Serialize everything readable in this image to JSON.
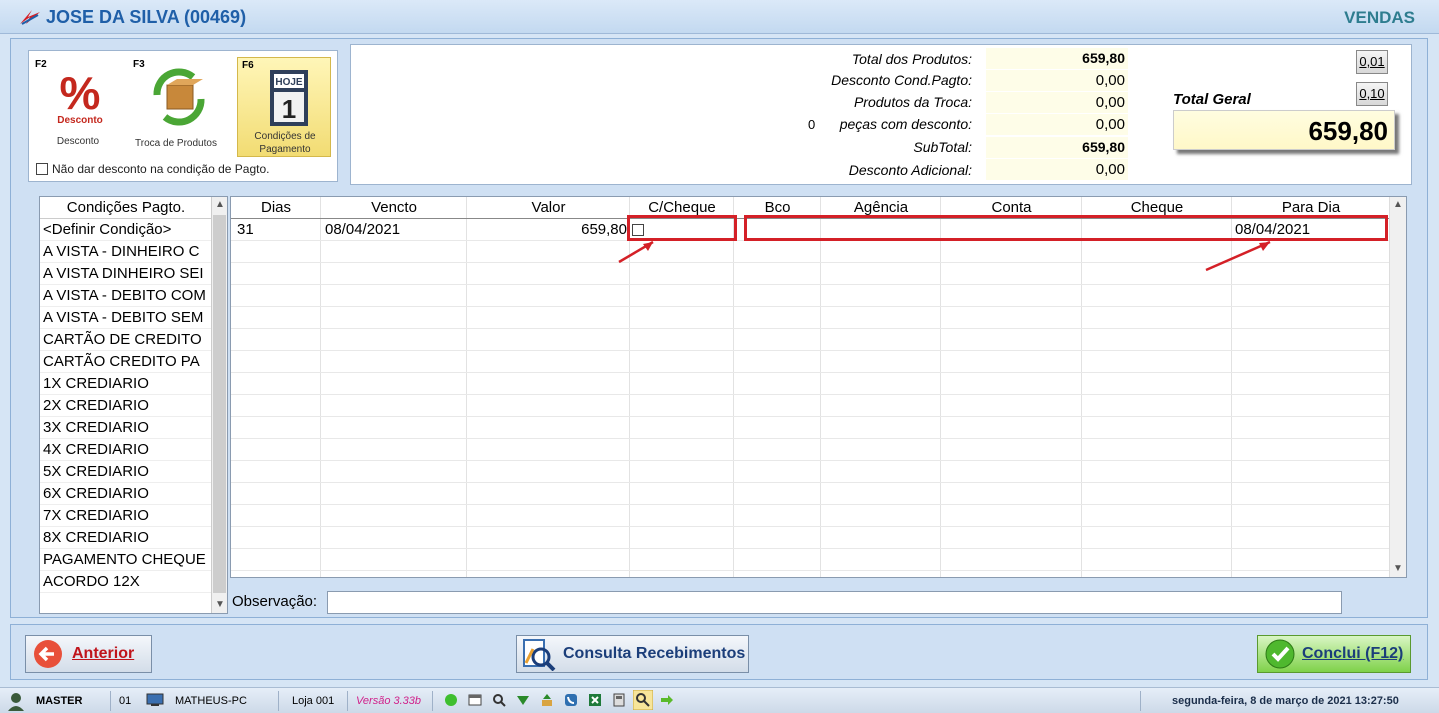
{
  "header": {
    "customer": "JOSE DA SILVA (00469)",
    "module": "VENDAS"
  },
  "tools": {
    "desconto": {
      "key": "F2",
      "label": "Desconto",
      "icon_text": "Desconto"
    },
    "troca": {
      "key": "F3",
      "label": "Troca de Produtos"
    },
    "condicoes": {
      "key": "F6",
      "label_line1": "Condições de",
      "label_line2": "Pagamento",
      "icon_text": "HOJE",
      "icon_num": "1"
    },
    "no_discount_label": "Não dar desconto na condição de Pagto."
  },
  "totals": {
    "total_produtos_label": "Total dos Produtos:",
    "total_produtos": "659,80",
    "desconto_cond_label": "Desconto Cond.Pagto:",
    "desconto_cond": "0,00",
    "produtos_troca_label": "Produtos da Troca:",
    "produtos_troca": "0,00",
    "pecas_count": "0",
    "pecas_label": "peças com desconto:",
    "pecas_desconto": "0,00",
    "subtotal_label": "SubTotal:",
    "subtotal": "659,80",
    "desconto_adic_label": "Desconto Adicional:",
    "desconto_adic": "0,00",
    "total_geral_label": "Total Geral",
    "total_geral": "659,80",
    "btn_001": "0,01",
    "btn_010": "0,10"
  },
  "conditions": {
    "header": "Condições Pagto.",
    "items": [
      "<Definir Condição>",
      "A VISTA - DINHEIRO C",
      "A VISTA DINHEIRO SEI",
      "A VISTA - DEBITO COM",
      "A VISTA - DEBITO SEM",
      "CARTÃO DE CREDITO",
      "CARTÃO CREDITO PA",
      "1X CREDIARIO",
      "2X CREDIARIO",
      "3X CREDIARIO",
      "4X CREDIARIO",
      "5X CREDIARIO",
      "6X CREDIARIO",
      "7X CREDIARIO",
      "8X CREDIARIO",
      "PAGAMENTO CHEQUE",
      "ACORDO 12X"
    ]
  },
  "grid": {
    "columns": [
      "Dias",
      "Vencto",
      "Valor",
      "C/Cheque",
      "Bco",
      "Agência",
      "Conta",
      "Cheque",
      "Para Dia"
    ],
    "row": {
      "dias": "31",
      "vencto": "08/04/2021",
      "valor": "659,80",
      "para_dia": "08/04/2021"
    }
  },
  "obs": {
    "label": "Observação:"
  },
  "buttons": {
    "anterior": "Anterior",
    "consulta": "Consulta Recebimentos",
    "concluir": "Conclui (F12)"
  },
  "status": {
    "user": "MASTER",
    "terminal": "01",
    "pc": "MATHEUS-PC",
    "loja": "Loja 001",
    "versao": "Versão 3.33b",
    "datetime": "segunda-feira, 8 de março de 2021 13:27:50"
  },
  "colors": {
    "accent": "#1f5fa8",
    "highlight": "#d42027",
    "confirm": "#7fd24a"
  }
}
